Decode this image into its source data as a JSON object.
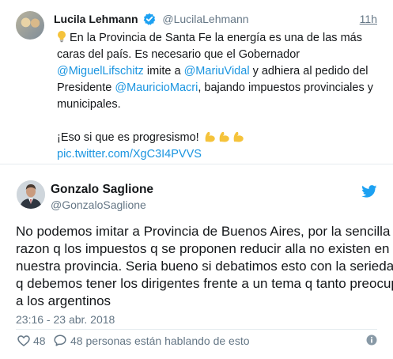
{
  "parent_tweet": {
    "name": "Lucila Lehmann",
    "handle": "@LucilaLehmann",
    "time": "11h",
    "lines": [
      {
        "pre": "En la Provincia de Santa Fe la energía es una de las más"
      },
      {
        "pre": "caras del país. Es necesario que el Gobernador"
      },
      {
        "mention": "@MiguelLifschitz",
        "mid": " imite a ",
        "mention2": "@MariuVidal",
        "post": " y adhiera al pedido del"
      },
      {
        "pre": "Presidente ",
        "mention": "@MauricioMacri",
        "post": ", bajando impuestos provinciales y"
      },
      {
        "pre": "municipales."
      }
    ],
    "closing": "¡Eso si que es progresismo!",
    "link": "pic.twitter.com/XgC3I4PVVS"
  },
  "main_tweet": {
    "name": "Gonzalo Saglione",
    "handle": "@GonzaloSaglione",
    "lines": [
      "No podemos imitar a Provincia de Buenos Aires, por la sencilla",
      "razon q los impuestos q se proponen reducir alla no existen en",
      "nuestra provincia. Seria bueno si debatimos esto con la seriedad",
      "q debemos tener los dirigentes frente a un tema q tanto preocupa",
      "a los argentinos"
    ],
    "timestamp": "23:16 - 23 abr. 2018",
    "likes": "48",
    "talking": "48 personas están hablando de esto"
  },
  "icons": {
    "verified": "verified-badge-icon",
    "bulb": "light-bulb-emoji-icon",
    "flexed": "flexed-biceps-emoji-icon",
    "bird": "twitter-bird-icon",
    "heart": "heart-icon",
    "reply": "speech-bubble-icon",
    "info": "info-icon"
  },
  "colors": {
    "link": "#1b95e0",
    "secondary": "#657786",
    "text": "#14171a",
    "divider": "#e6ecf0",
    "brand": "#1da1f2",
    "emoji": "#f5c33b"
  }
}
